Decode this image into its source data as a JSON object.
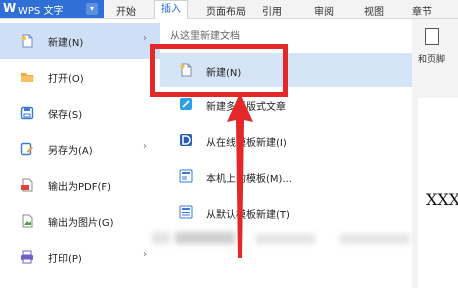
{
  "ribbon": {
    "app_logo": "W",
    "app_name": "WPS 文字",
    "dropdown_glyph": "▾",
    "tabs": [
      "开始",
      "插入",
      "页面布局",
      "引用",
      "审阅",
      "视图",
      "章节"
    ],
    "active_tab": "插入"
  },
  "left_menu": {
    "items": [
      {
        "label": "新建(N)",
        "icon": "new-document-icon",
        "has_submenu": true,
        "selected": true
      },
      {
        "label": "打开(O)",
        "icon": "folder-open-icon",
        "has_submenu": false
      },
      {
        "label": "保存(S)",
        "icon": "save-icon",
        "has_submenu": false
      },
      {
        "label": "另存为(A)",
        "icon": "save-as-icon",
        "has_submenu": true
      },
      {
        "label": "输出为PDF(F)",
        "icon": "pdf-export-icon",
        "has_submenu": false
      },
      {
        "label": "输出为图片(G)",
        "icon": "image-export-icon",
        "has_submenu": false
      },
      {
        "label": "打印(P)",
        "icon": "printer-icon",
        "has_submenu": true
      }
    ],
    "submenu_arrow": "›"
  },
  "submenu": {
    "header": "从这里新建文档",
    "items": [
      {
        "label": "新建(N)",
        "icon": "blank-document-icon",
        "selected": true
      },
      {
        "label": "新建多彩版式文章",
        "icon": "colorful-layout-icon"
      },
      {
        "label": "从在线模板新建(I)",
        "icon": "online-template-icon"
      },
      {
        "label": "本机上的模板(M)...",
        "icon": "local-template-icon"
      },
      {
        "label": "从默认模板新建(T)",
        "icon": "default-template-icon"
      }
    ]
  },
  "document": {
    "ribbon_label": "和页脚",
    "body_text": "XXX"
  },
  "colors": {
    "brand_blue": "#2f6fd6",
    "selection": "#cfe0f6",
    "annotation_red": "#e3282a"
  }
}
